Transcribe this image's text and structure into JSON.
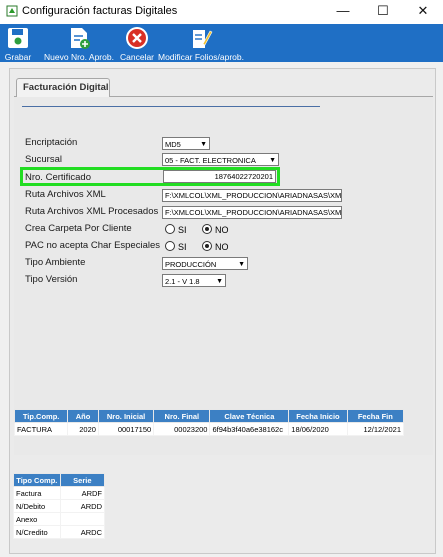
{
  "window": {
    "title": "Configuración facturas Digitales",
    "minimize": "—",
    "maximize": "☐",
    "close": "✕"
  },
  "toolbar": {
    "grabar": "Grabar",
    "nuevo": "Nuevo Nro. Aprob.",
    "cancelar": "Cancelar",
    "modificar": "Modificar Folios/aprob."
  },
  "tab": {
    "label": "Facturación Digital"
  },
  "form": {
    "encriptacion": {
      "label": "Encriptación",
      "value": "MD5"
    },
    "sucursal": {
      "label": "Sucursal",
      "value": "05 - FACT. ELECTRONICA"
    },
    "nro_certificado": {
      "label": "Nro. Certificado",
      "value": "18764022720201"
    },
    "ruta_xml": {
      "label": "Ruta Archivos XML",
      "value": "F:\\XMLCOL\\XML_PRODUCCION\\ARIADNASAS\\XML_"
    },
    "ruta_xml_proc": {
      "label": "Ruta Archivos XML Procesados",
      "value": "F:\\XMLCOL\\XML_PRODUCCION\\ARIADNASAS\\XML_"
    },
    "crea_carpeta": {
      "label": "Crea Carpeta Por Cliente",
      "si": "SI",
      "no": "NO",
      "selected": "NO"
    },
    "pac": {
      "label": "PAC no acepta Char Especiales",
      "si": "SI",
      "no": "NO",
      "selected": "NO"
    },
    "tipo_ambiente": {
      "label": "Tipo Ambiente",
      "value": "PRODUCCIÓN"
    },
    "tipo_version": {
      "label": "Tipo Versión",
      "value": "2.1 - V 1.8"
    }
  },
  "folios_table": {
    "headers": [
      "Tip.Comp.",
      "Año",
      "Nro. Inicial",
      "Nro. Final",
      "Clave Técnica",
      "Fecha Inicio",
      "Fecha Fin"
    ],
    "rows": [
      [
        "FACTURA",
        "2020",
        "00017150",
        "00023200",
        "6f94b3f40a6e38162c",
        "18/06/2020",
        "12/12/2021"
      ]
    ]
  },
  "series_table": {
    "headers": [
      "Tipo Comp.",
      "Serie"
    ],
    "rows": [
      [
        "Factura",
        "ARDF"
      ],
      [
        "N/Debito",
        "ARDD"
      ],
      [
        "Anexo",
        ""
      ],
      [
        "N/Credito",
        "ARDC"
      ]
    ]
  },
  "colors": {
    "toolbar": "#1f6fc5",
    "table_header": "#3c80c4",
    "highlight": "#22dd22"
  }
}
